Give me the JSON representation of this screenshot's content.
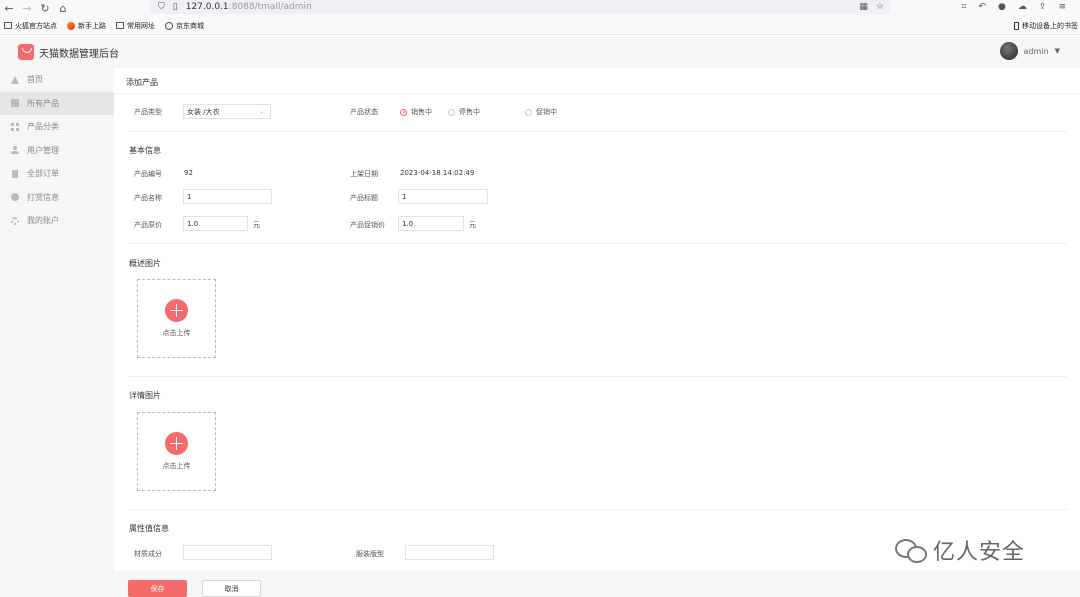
{
  "browser": {
    "url_host": "127.0.0.1",
    "url_rest": ":8088/tmall/admin",
    "bookmarks": [
      "火狐官方站点",
      "新手上路",
      "常用网址",
      "京东商城"
    ],
    "mobile_bookmarks": "移动设备上的书签"
  },
  "header": {
    "title": "天猫数据管理后台",
    "user": "admin"
  },
  "sidebar": {
    "items": [
      {
        "label": "首页",
        "icon": "home-icon"
      },
      {
        "label": "所有产品",
        "icon": "product-icon"
      },
      {
        "label": "产品分类",
        "icon": "category-icon"
      },
      {
        "label": "用户管理",
        "icon": "user-icon"
      },
      {
        "label": "全部订单",
        "icon": "order-icon"
      },
      {
        "label": "打赏信息",
        "icon": "reward-icon"
      },
      {
        "label": "我的账户",
        "icon": "account-icon"
      }
    ],
    "active_index": 1
  },
  "page": {
    "title": "添加产品",
    "product_type_label": "产品类型",
    "product_type_value": "女装 /大衣",
    "status_label": "产品状态",
    "status_options": [
      "销售中",
      "停售中",
      "促销中"
    ],
    "status_selected": "销售中",
    "basic_section": "基本信息",
    "id_label": "产品编号",
    "id_value": "92",
    "date_label": "上架日期",
    "date_value": "2023-04-18 14:02:49",
    "name_label": "产品名称",
    "name_value": "1",
    "subtitle_label": "产品标题",
    "subtitle_value": "1",
    "price_label": "产品原价",
    "price_value": "1.0",
    "price_unit": "元",
    "promo_label": "产品促销价",
    "promo_value": "1.0",
    "promo_unit": "元",
    "overview_section": "概述图片",
    "detail_section": "详情图片",
    "upload_text": "点击上传",
    "attr_section": "属性值信息",
    "material_label": "材质成分",
    "material_value": "",
    "style_label": "服装版型",
    "style_value": ""
  },
  "footer": {
    "save_label": "保存",
    "cancel_label": "取消"
  },
  "watermark": "亿人安全",
  "colors": {
    "accent": "#f56a6a",
    "sidebar_bg": "#f6f6f6",
    "active_bg": "#e6e6e6"
  }
}
